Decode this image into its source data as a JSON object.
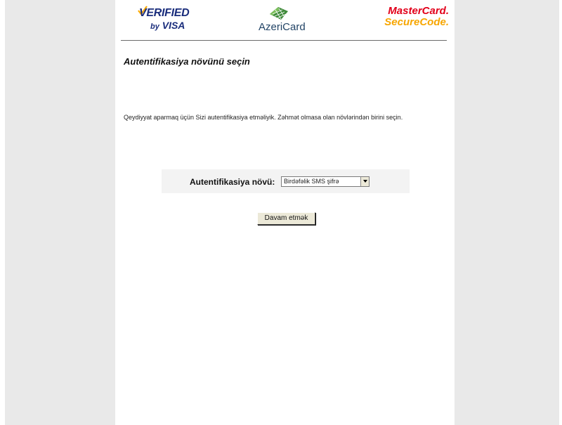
{
  "header": {
    "visa_logo": {
      "line1": "VERIFIED",
      "line2_prefix": "by",
      "line2_brand": "VISA",
      "color": "#1a2d7c"
    },
    "azericard_logo": {
      "text": "AzeriCard",
      "color": "#224466"
    },
    "mastercard_logo": {
      "line1": "MasterCard.",
      "line2": "SecureCode.",
      "color_primary": "#e2001a",
      "color_secondary": "#f7a600"
    }
  },
  "page": {
    "title": "Autentifikasiya növünü seçin",
    "instruction": "Qeydiyyat aparmaq üçün Sizi autentifikasiya etməliyik. Zəhmət olmasa olan növlərindən birini seçin."
  },
  "auth_form": {
    "label": "Autentifikasiya növü:",
    "selected_value": "Birdəfəlik SMS şifrə",
    "submit_label": "Davam etmək"
  },
  "colors": {
    "background": "#e9e9e9",
    "page": "#ffffff",
    "panel": "#f3f3f3"
  }
}
